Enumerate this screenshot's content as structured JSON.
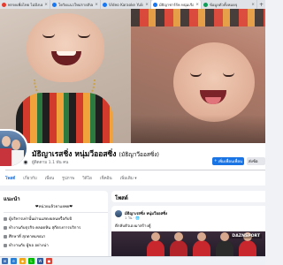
{
  "browser": {
    "tabs": [
      {
        "title": "พรรคเพื่อไทย ไม่มีงบตอบ",
        "color": "#e63b2e",
        "active": false
      },
      {
        "title": "โควิดแนวใหม่รายสัปดาห์ 0",
        "color": "#1877f2",
        "active": false
      },
      {
        "title": "Video Karaoke Yulin",
        "color": "#1877f2",
        "active": false
      },
      {
        "title": "มัธิญาชาร์ร์ห หนุ่มเรือ",
        "color": "#1877f2",
        "active": true
      },
      {
        "title": "ข้อมูลตัวทั้งหมดจุ",
        "color": "#0f9d58",
        "active": false
      }
    ],
    "tab_close": "×",
    "new_tab": "+"
  },
  "profile": {
    "name": "มัธิญาเรสชิ่ง หนุ่มวีออสซิ่ง",
    "alt_name": "(มัธิญาวีออสซิ่ง)",
    "followers": "ผู้ติดตาม 1.1 พัน คน",
    "primary_button": "เพิ่มเพื่อนเพื่อน",
    "primary_icon": "+",
    "secondary_button": "ส่งข้อ",
    "camera_icon": "◉"
  },
  "nav": {
    "items": [
      {
        "label": "โพสต์",
        "active": true
      },
      {
        "label": "เกี่ยวกับ",
        "active": false
      },
      {
        "label": "เพื่อน",
        "active": false
      },
      {
        "label": "รูปภาพ",
        "active": false
      },
      {
        "label": "วิดีโอ",
        "active": false
      },
      {
        "label": "เช็คอิน",
        "active": false
      },
      {
        "label": "เพิ่มเติม ▾",
        "active": false
      }
    ]
  },
  "intro": {
    "title": "แนะนำ",
    "bio": "❤หน่วยแล้วยาแยพย❤",
    "rows": [
      "ผู้บริหารเท่านั้นผ่านแสดงผลนหรือกับบิ",
      "ทำงานกับธุรกิจ คลอดหิน สุกีตรงการบริการ",
      "ศึกษาที่ สุภดาคมขณา",
      "ทำงานกับ ผู้ขอ อย่างน่า"
    ]
  },
  "post": {
    "section_title": "โพสต์",
    "author": "มัธิญาเรสซิ่ง หนุ่มวีออสซิ่ง",
    "time": "1 วัน · 🌐",
    "text": "ดีกลับตัวเองมาสร้างตู้",
    "badge": "DAZNSPORT"
  },
  "taskbar": {
    "icons": [
      {
        "label": "⊞",
        "color": "#3b6fb6"
      },
      {
        "label": "e",
        "color": "#2a7fd4"
      },
      {
        "label": "◆",
        "color": "#f0a71b"
      },
      {
        "label": "L",
        "color": "#00b900"
      },
      {
        "label": "W",
        "color": "#2b579a"
      },
      {
        "label": "●",
        "color": "#db4437"
      }
    ]
  },
  "colors": {
    "fb_blue": "#1b74e4",
    "background": "#f0f2f5",
    "text": "#050505",
    "muted": "#65676b"
  }
}
